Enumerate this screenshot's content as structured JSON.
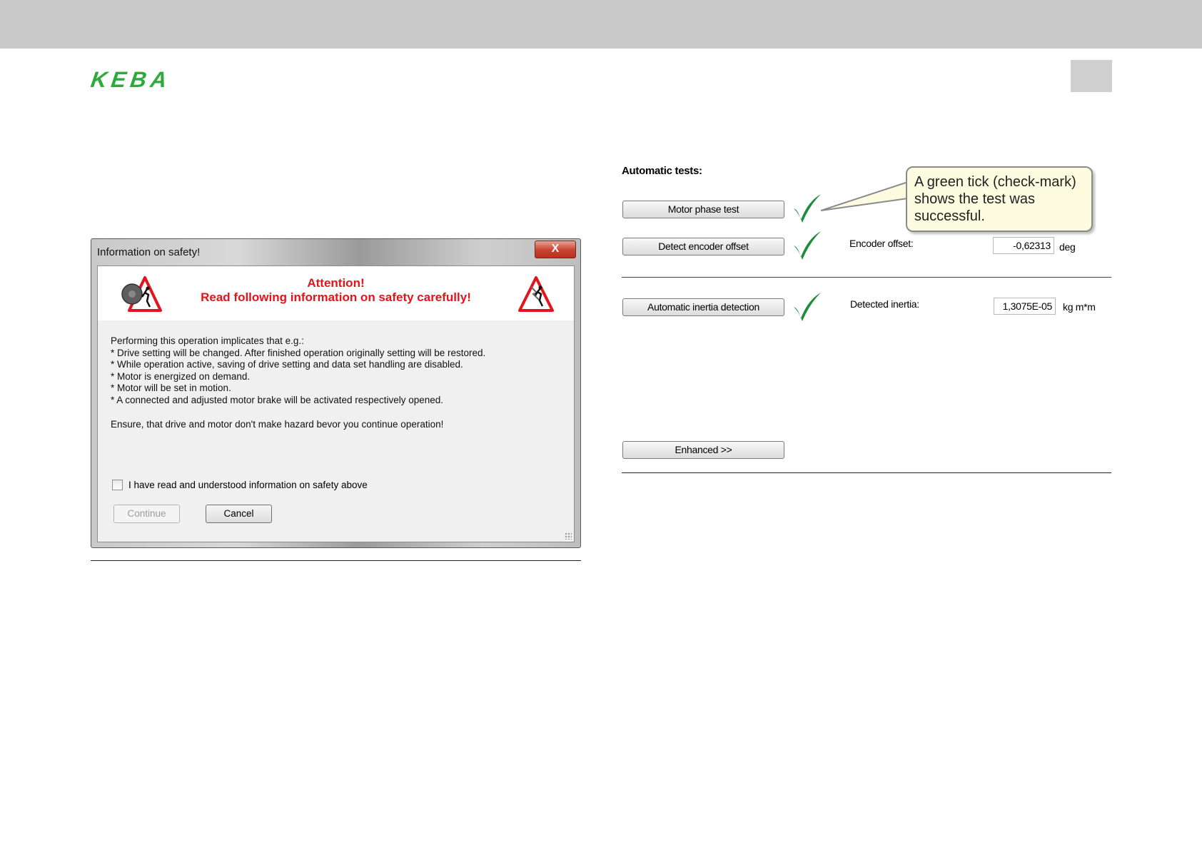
{
  "header": {
    "logo": "KEBA"
  },
  "dialog": {
    "title": "Information on safety!",
    "close_label": "X",
    "attention_line1": "Attention!",
    "attention_line2": "Read following information on safety carefully!",
    "body_lines": [
      "Performing this operation implicates that e.g.:",
      "* Drive setting will be changed. After finished operation originally setting will be restored.",
      "* While operation active, saving of drive setting and data set handling are disabled.",
      "* Motor is energized on demand.",
      "* Motor will be set in motion.",
      "* A connected and adjusted motor brake will be activated respectively opened."
    ],
    "ensure_text": "Ensure, that drive and motor don't make hazard bevor you continue operation!",
    "checkbox_label": "I have read and understood information on safety above",
    "checkbox_checked": false,
    "continue_label": "Continue",
    "cancel_label": "Cancel"
  },
  "tests": {
    "title": "Automatic tests:",
    "motor_phase_label": "Motor phase test",
    "encoder_offset_button": "Detect encoder offset",
    "encoder_offset_label": "Encoder offset:",
    "encoder_offset_value": "-0,62313",
    "encoder_offset_unit": "deg",
    "inertia_button": "Automatic inertia detection",
    "inertia_label": "Detected inertia:",
    "inertia_value": "1,3075E-05",
    "inertia_unit": "kg m*m",
    "enhanced_label": "Enhanced >>",
    "tick_color": "#1e8c3a"
  },
  "callout": {
    "line1": "A green tick (check-mark)",
    "line2": "shows the test was",
    "line3": "successful."
  }
}
